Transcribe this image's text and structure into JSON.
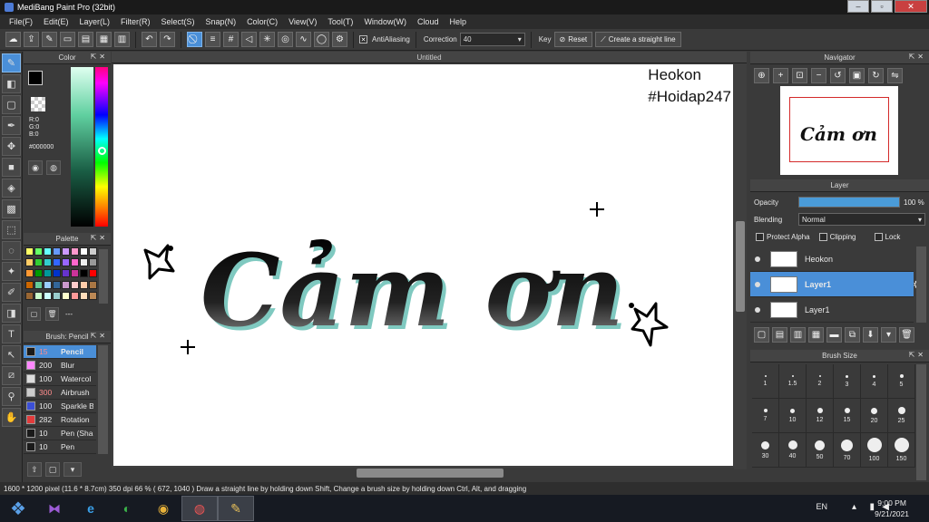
{
  "window": {
    "title": "MediBang Paint Pro (32bit)",
    "controls": [
      "–",
      "▫",
      "✕"
    ]
  },
  "menu": [
    "File(F)",
    "Edit(E)",
    "Layer(L)",
    "Filter(R)",
    "Select(S)",
    "Snap(N)",
    "Color(C)",
    "View(V)",
    "Tool(T)",
    "Window(W)",
    "Cloud",
    "Help"
  ],
  "toolbar": {
    "antialiasing_label": "AntiAliasing",
    "correction_label": "Correction",
    "correction_value": "40",
    "key_label": "Key",
    "reset_label": "Reset",
    "straight_line_label": "Create a straight line"
  },
  "color_panel": {
    "title": "Color",
    "r": "R:0",
    "g": "G:0",
    "b": "B:0",
    "hex": "#000000",
    "primary_color": "#000000",
    "secondary_color": "#ff6600"
  },
  "palette": {
    "title": "Palette",
    "swatches": [
      "#ffff66",
      "#66ff66",
      "#66ffff",
      "#6699ff",
      "#cc99ff",
      "#ff99cc",
      "#ffffff",
      "#cccccc",
      "#ffcc66",
      "#33cc33",
      "#33cccc",
      "#3366ff",
      "#9966ff",
      "#ff66cc",
      "#eeeeee",
      "#999999",
      "#ff9933",
      "#009900",
      "#009999",
      "#0033cc",
      "#6633cc",
      "#cc3399",
      "#000000",
      "#ff0000",
      "#cc6600",
      "#66cc99",
      "#99ccff",
      "#336699",
      "#cc99cc",
      "#ffcccc",
      "#ffccaa",
      "#aa7744",
      "#996633",
      "#ccffcc",
      "#ccffff",
      "#99cccc",
      "#ffffcc",
      "#ff9999",
      "#ffddbb",
      "#bb8855"
    ],
    "dashes": "---"
  },
  "brush": {
    "title": "Brush: Pencil",
    "items": [
      {
        "size": "15",
        "name": "Pencil",
        "color": "#1a1a1a",
        "selected": true
      },
      {
        "size": "200",
        "name": "Blur",
        "color": "#ff88ff"
      },
      {
        "size": "100",
        "name": "Watercol",
        "color": "#dddddd"
      },
      {
        "size": "300",
        "name": "Airbrush",
        "color": "#cccccc"
      },
      {
        "size": "100",
        "name": "Sparkle B",
        "color": "#3b4fd6"
      },
      {
        "size": "282",
        "name": "Rotation",
        "color": "#e23b3b"
      },
      {
        "size": "10",
        "name": "Pen (Sha",
        "color": "#1a1a1a"
      },
      {
        "size": "10",
        "name": "Pen",
        "color": "#1a1a1a"
      }
    ]
  },
  "canvas": {
    "tab_title": "Untitled",
    "watermark_line1": "Heokon",
    "watermark_line2": "#Hoidap247",
    "art_text": "Cảm ơn"
  },
  "navigator": {
    "title": "Navigator"
  },
  "layers": {
    "title": "Layer",
    "opacity_label": "Opacity",
    "opacity_value": "100 %",
    "opacity_fraction": 1.0,
    "blending_label": "Blending",
    "blending_value": "Normal",
    "protect_alpha": "Protect Alpha",
    "clipping": "Clipping",
    "lock": "Lock",
    "items": [
      {
        "name": "Heokon",
        "selected": false
      },
      {
        "name": "Layer1",
        "selected": true
      },
      {
        "name": "Layer1",
        "selected": false
      }
    ]
  },
  "brush_size": {
    "title": "Brush Size",
    "sizes": [
      "1",
      "1.5",
      "2",
      "3",
      "4",
      "5",
      "7",
      "10",
      "12",
      "15",
      "20",
      "25",
      "30",
      "40",
      "50",
      "70",
      "100",
      "150"
    ]
  },
  "status": {
    "text": "1600 * 1200 pixel  (11.6 * 8.7cm)  350 dpi  66 %  ( 672, 1040 )  Draw a straight line by holding down Shift, Change a brush size by holding down Ctrl, Alt, and dragging"
  },
  "taskbar": {
    "language": "EN",
    "time": "9:00 PM",
    "date": "9/21/2021"
  }
}
